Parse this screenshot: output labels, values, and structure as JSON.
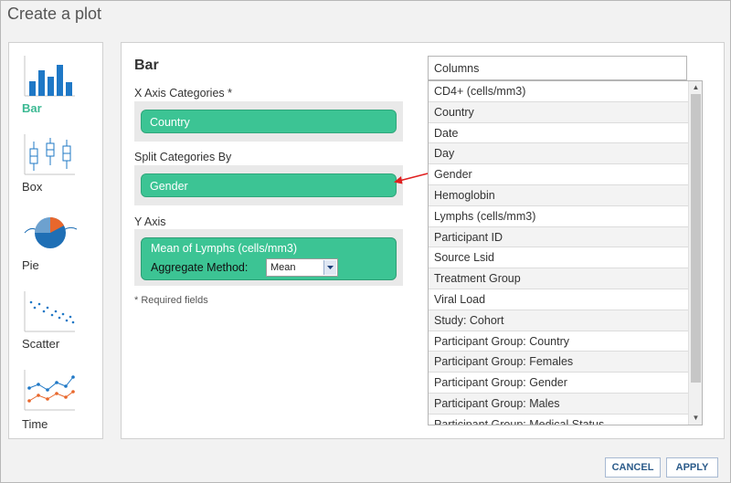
{
  "dialog": {
    "title": "Create a plot"
  },
  "plot_types": [
    {
      "label": "Bar",
      "icon": "bar-chart-icon",
      "selected": true
    },
    {
      "label": "Box",
      "icon": "box-plot-icon"
    },
    {
      "label": "Pie",
      "icon": "pie-chart-icon"
    },
    {
      "label": "Scatter",
      "icon": "scatter-plot-icon"
    },
    {
      "label": "Time",
      "icon": "time-chart-icon"
    }
  ],
  "config": {
    "chart_type": "Bar",
    "x_axis": {
      "label": "X Axis Categories *",
      "value": "Country"
    },
    "split": {
      "label": "Split Categories By",
      "value": "Gender"
    },
    "y_axis": {
      "label": "Y Axis",
      "value": "Mean of Lymphs (cells/mm3)",
      "aggregate_label": "Aggregate Method:",
      "aggregate_value": "Mean"
    },
    "required_note": "* Required fields"
  },
  "columns": {
    "header": "Columns",
    "items": [
      "CD4+ (cells/mm3)",
      "Country",
      "Date",
      "Day",
      "Gender",
      "Hemoglobin",
      "Lymphs (cells/mm3)",
      "Participant ID",
      "Source Lsid",
      "Treatment Group",
      "Viral Load",
      "Study: Cohort",
      "Participant Group: Country",
      "Participant Group: Females",
      "Participant Group: Gender",
      "Participant Group: Males",
      "Participant Group: Medical Status"
    ]
  },
  "buttons": {
    "cancel": "CANCEL",
    "apply": "APPLY"
  },
  "colors": {
    "accent": "#3cc494",
    "pie_orange": "#e8672c",
    "pie_blue": "#1f6fb5",
    "arrow_red": "#e02020"
  }
}
